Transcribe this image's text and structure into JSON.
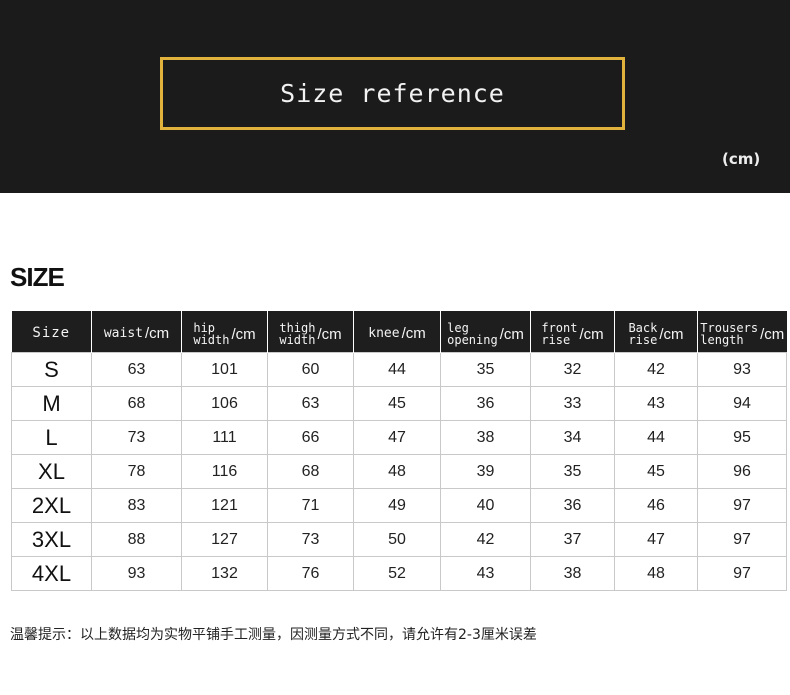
{
  "banner": {
    "title": "Size reference",
    "unit": "(cm)"
  },
  "section_heading": "SIZE",
  "table": {
    "headers": [
      {
        "label": "Size",
        "unit": ""
      },
      {
        "label": "waist",
        "unit": "/cm"
      },
      {
        "label": "hip\nwidth",
        "unit": "/cm"
      },
      {
        "label": "thigh\nwidth",
        "unit": "/cm"
      },
      {
        "label": "knee",
        "unit": "/cm"
      },
      {
        "label": "leg\nopening",
        "unit": "/cm"
      },
      {
        "label": "front\nrise",
        "unit": "/cm"
      },
      {
        "label": "Back\nrise",
        "unit": "/cm"
      },
      {
        "label": "Trousers\nlength",
        "unit": "/cm"
      }
    ],
    "rows": [
      [
        "S",
        "63",
        "101",
        "60",
        "44",
        "35",
        "32",
        "42",
        "93"
      ],
      [
        "M",
        "68",
        "106",
        "63",
        "45",
        "36",
        "33",
        "43",
        "94"
      ],
      [
        "L",
        "73",
        "111",
        "66",
        "47",
        "38",
        "34",
        "44",
        "95"
      ],
      [
        "XL",
        "78",
        "116",
        "68",
        "48",
        "39",
        "35",
        "45",
        "96"
      ],
      [
        "2XL",
        "83",
        "121",
        "71",
        "49",
        "40",
        "36",
        "46",
        "97"
      ],
      [
        "3XL",
        "88",
        "127",
        "73",
        "50",
        "42",
        "37",
        "47",
        "97"
      ],
      [
        "4XL",
        "93",
        "132",
        "76",
        "52",
        "43",
        "38",
        "48",
        "97"
      ]
    ]
  },
  "note": "温馨提示：以上数据均为实物平铺手工测量，因测量方式不同，请允许有2-3厘米误差"
}
